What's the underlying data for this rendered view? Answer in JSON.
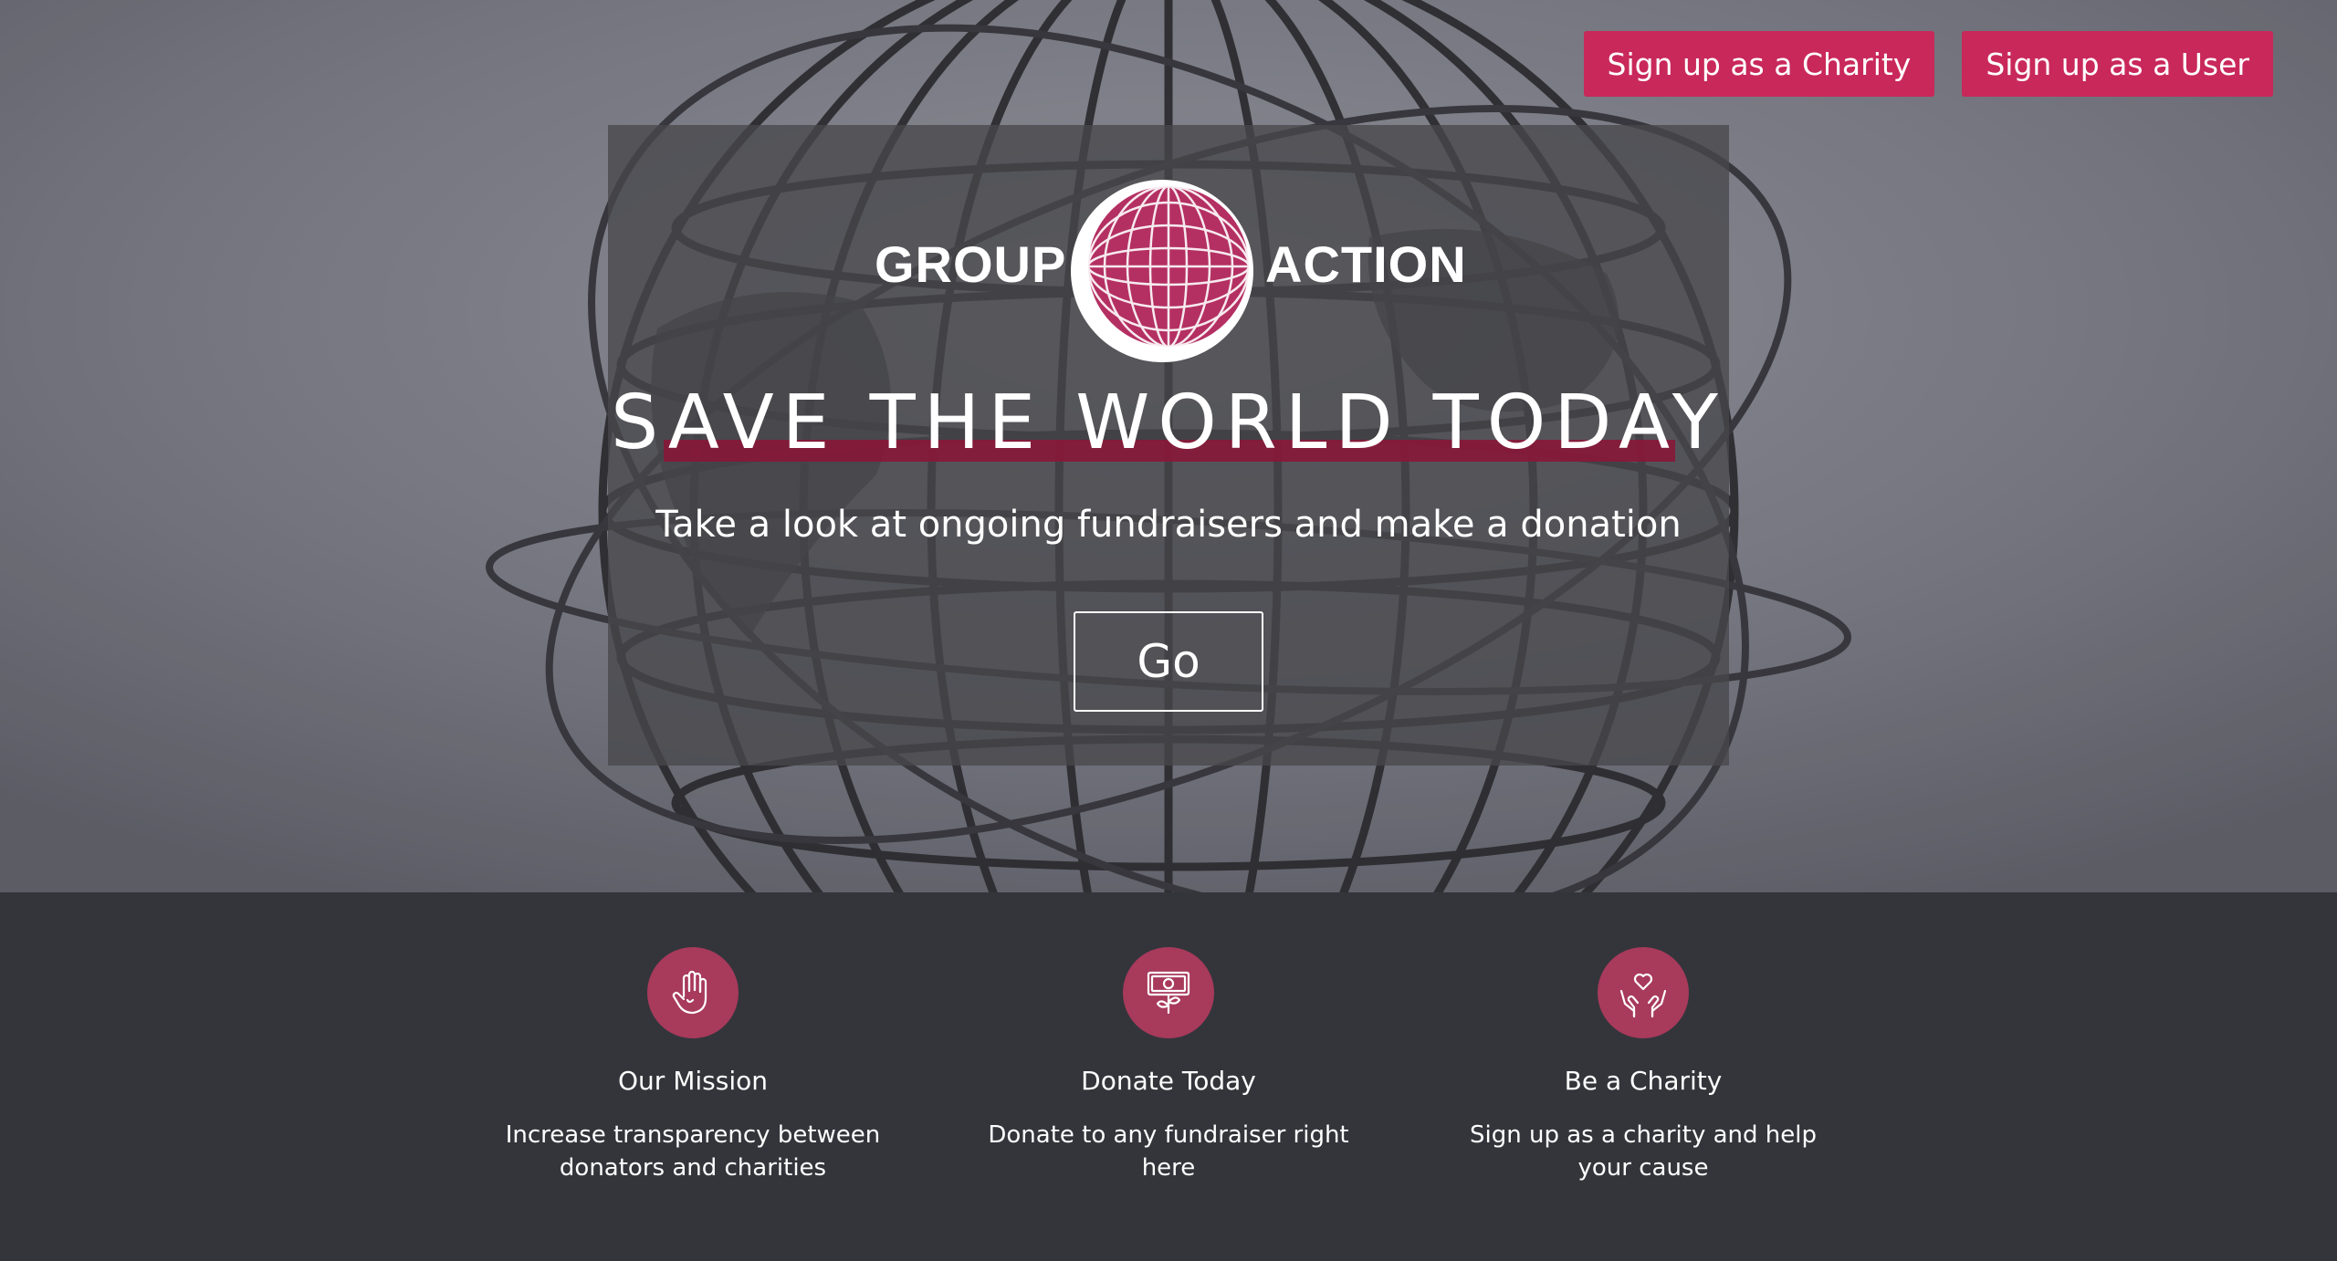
{
  "header": {
    "signup_charity_label": "Sign up as a Charity",
    "signup_user_label": "Sign up as a User"
  },
  "logo": {
    "word_left": "GROUP",
    "word_right": "ACTION"
  },
  "hero": {
    "headline": "SAVE THE WORLD TODAY",
    "subtext": "Take a look at ongoing fundraisers and make a donation",
    "go_label": "Go"
  },
  "features": [
    {
      "icon": "hand-icon",
      "title": "Our Mission",
      "text": "Increase transparency between donators and charities"
    },
    {
      "icon": "money-plant-icon",
      "title": "Donate Today",
      "text": "Donate to any fundraiser right here"
    },
    {
      "icon": "hands-heart-icon",
      "title": "Be a Charity",
      "text": "Sign up as a charity and help your cause"
    }
  ],
  "colors": {
    "accent": "#c9285a",
    "icon_circle": "#a83a5c",
    "footer_bg": "#34353b"
  }
}
